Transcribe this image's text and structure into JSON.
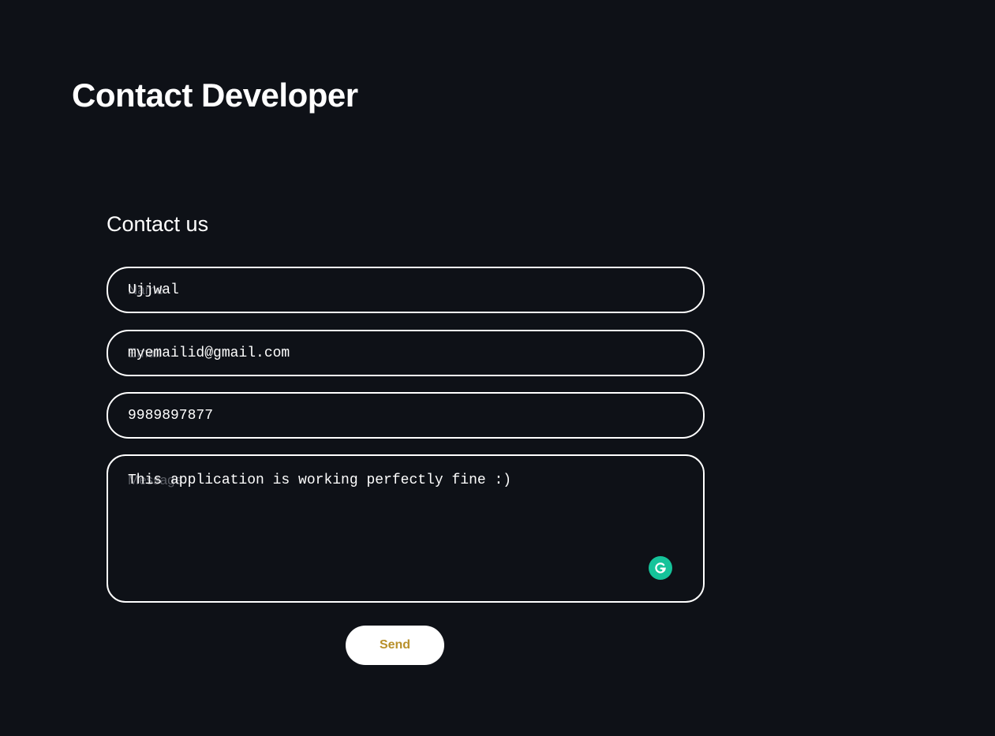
{
  "page": {
    "title": "Contact Developer"
  },
  "form": {
    "heading": "Contact us",
    "name": {
      "placeholder": "Name",
      "value": "Ujjwal"
    },
    "email": {
      "placeholder": "Email",
      "value": "myemailid@gmail.com"
    },
    "phone": {
      "value": "9989897877"
    },
    "message": {
      "placeholder": "Message",
      "value": "This application is working perfectly fine :)"
    },
    "send_label": "Send"
  },
  "icons": {
    "grammarly": "grammarly-icon"
  },
  "colors": {
    "background": "#0e1117",
    "text": "#ffffff",
    "button_text": "#b8902a",
    "grammarly": "#15c39a"
  }
}
